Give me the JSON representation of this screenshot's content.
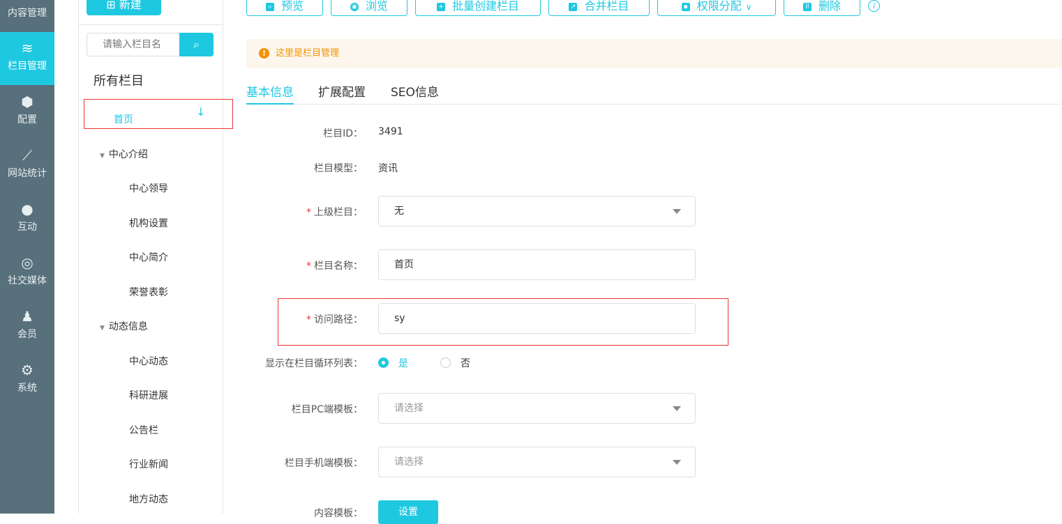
{
  "sidebar": {
    "items": [
      {
        "label": "内容管理",
        "icon": "edit-icon"
      },
      {
        "label": "栏目管理",
        "icon": "layers-icon"
      },
      {
        "label": "配置",
        "icon": "cube-icon"
      },
      {
        "label": "网站统计",
        "icon": "chart-icon"
      },
      {
        "label": "互动",
        "icon": "chat-icon"
      },
      {
        "label": "社交媒体",
        "icon": "social-icon"
      },
      {
        "label": "会员",
        "icon": "user-icon"
      },
      {
        "label": "系统",
        "icon": "gear-icon"
      }
    ]
  },
  "column_panel": {
    "new_label": "新建",
    "search_placeholder": "请输入栏目名",
    "all_title": "所有栏目",
    "tree": [
      {
        "label": "首页"
      },
      {
        "label": "中心介绍"
      },
      {
        "label": "中心领导"
      },
      {
        "label": "机构设置"
      },
      {
        "label": "中心简介"
      },
      {
        "label": "荣誉表彰"
      },
      {
        "label": "动态信息"
      },
      {
        "label": "中心动态"
      },
      {
        "label": "科研进展"
      },
      {
        "label": "公告栏"
      },
      {
        "label": "行业新闻"
      },
      {
        "label": "地方动态"
      }
    ]
  },
  "toolbar": {
    "preview": "预览",
    "browse": "浏览",
    "batch_create": "批量创建栏目",
    "merge": "合并栏目",
    "permissions": "权限分配",
    "delete": "删除"
  },
  "alert": "这里是栏目管理",
  "tabs": [
    "基本信息",
    "扩展配置",
    "SEO信息"
  ],
  "form": {
    "id_label": "栏目ID：",
    "id_value": "3491",
    "model_label": "栏目模型：",
    "model_value": "资讯",
    "parent_label": "上级栏目：",
    "parent_value": "无",
    "name_label": "栏目名称：",
    "name_value": "首页",
    "path_label": "访问路径：",
    "path_value": "sy",
    "show_label": "显示在栏目循环列表：",
    "yes": "是",
    "no": "否",
    "pc_label": "栏目PC端模板：",
    "pc_placeholder": "请选择",
    "mobile_label": "栏目手机端模板：",
    "mobile_placeholder": "请选择",
    "content_label": "内容模板：",
    "set_label": "设置"
  },
  "colors": {
    "accent": "#1fc8e1",
    "sidebar": "#57707c",
    "warning": "#f39200"
  }
}
